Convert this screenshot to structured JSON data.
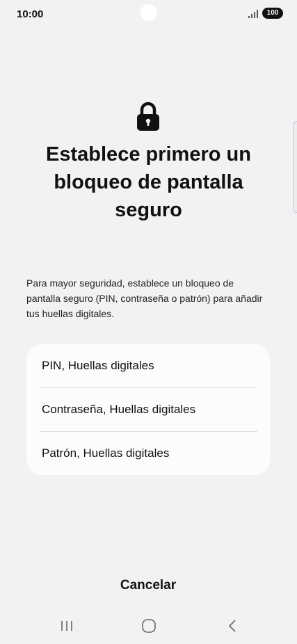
{
  "status_bar": {
    "time": "10:00",
    "battery": "100",
    "icons": [
      "signal-icon",
      "battery-icon"
    ]
  },
  "icon": "lock-icon",
  "title": "Establece primero un bloqueo de pantalla seguro",
  "description": "Para mayor seguridad, establece un bloqueo de pantalla seguro (PIN, contraseña o patrón) para añadir tus huellas digitales.",
  "options": [
    {
      "label": "PIN, Huellas digitales"
    },
    {
      "label": "Contraseña, Huellas digitales"
    },
    {
      "label": "Patrón, Huellas digitales"
    }
  ],
  "cancel_label": "Cancelar",
  "nav_bar": {
    "icons": [
      "recents-icon",
      "home-icon",
      "back-icon"
    ]
  }
}
